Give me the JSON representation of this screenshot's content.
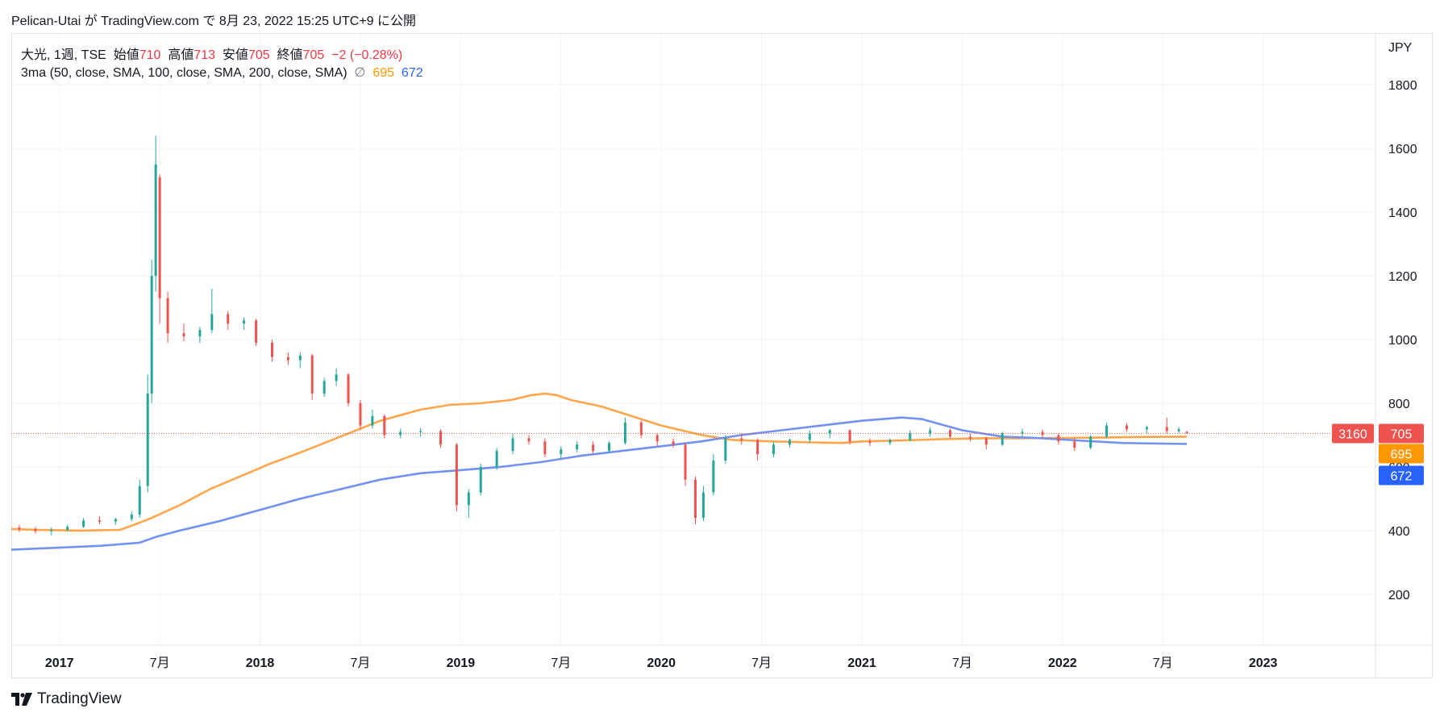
{
  "caption": "Pelican-Utai が TradingView.com で 8月 23, 2022 15:25 UTC+9 に公開",
  "legend": {
    "symbol": "大光, 1週, TSE",
    "open_label": "始値",
    "open": "710",
    "high_label": "高値",
    "high": "713",
    "low_label": "安値",
    "low": "705",
    "close_label": "終値",
    "close": "705",
    "change": "−2 (−0.28%)",
    "indicator": "3ma (50, close, SMA, 100, close, SMA, 200, close, SMA)",
    "hidden_symbol": "∅",
    "ma1_value": "695",
    "ma2_value": "672"
  },
  "currency": "JPY",
  "footer": {
    "brand": "TradingView"
  },
  "colors": {
    "up": "#26a69a",
    "down": "#ef5350",
    "ma1": "#ffa64d",
    "ma2": "#7391f0",
    "badge_countdown": "#ef5350"
  },
  "badges": {
    "countdown": "3160",
    "price": "705",
    "ma1": "695",
    "ma2": "672"
  },
  "chart_data": {
    "type": "candlestick",
    "title": "",
    "ylabel": "JPY",
    "ylim": [
      40,
      1960
    ],
    "y_ticks": [
      200,
      400,
      600,
      800,
      1000,
      1200,
      1400,
      1600,
      1800
    ],
    "x_ticks": [
      {
        "label": "2017",
        "t": 2017.0
      },
      {
        "label": "7月",
        "t": 2017.5
      },
      {
        "label": "2018",
        "t": 2018.0
      },
      {
        "label": "7月",
        "t": 2018.5
      },
      {
        "label": "2019",
        "t": 2019.0
      },
      {
        "label": "7月",
        "t": 2019.5
      },
      {
        "label": "2020",
        "t": 2020.0
      },
      {
        "label": "7月",
        "t": 2020.5
      },
      {
        "label": "2021",
        "t": 2021.0
      },
      {
        "label": "7月",
        "t": 2021.5
      },
      {
        "label": "2022",
        "t": 2022.0
      },
      {
        "label": "7月",
        "t": 2022.5
      },
      {
        "label": "2023",
        "t": 2023.0
      }
    ],
    "xlim": [
      2016.76,
      2023.56
    ],
    "last_price": 705,
    "grid": true,
    "candles": [
      {
        "t": 2016.8,
        "o": 410,
        "h": 418,
        "l": 395,
        "c": 405
      },
      {
        "t": 2016.88,
        "o": 405,
        "h": 412,
        "l": 390,
        "c": 398
      },
      {
        "t": 2016.96,
        "o": 398,
        "h": 410,
        "l": 385,
        "c": 402
      },
      {
        "t": 2017.04,
        "o": 402,
        "h": 418,
        "l": 398,
        "c": 412
      },
      {
        "t": 2017.12,
        "o": 412,
        "h": 440,
        "l": 408,
        "c": 432
      },
      {
        "t": 2017.2,
        "o": 432,
        "h": 445,
        "l": 420,
        "c": 428
      },
      {
        "t": 2017.28,
        "o": 428,
        "h": 440,
        "l": 418,
        "c": 436
      },
      {
        "t": 2017.36,
        "o": 436,
        "h": 460,
        "l": 430,
        "c": 450
      },
      {
        "t": 2017.4,
        "o": 450,
        "h": 560,
        "l": 440,
        "c": 540
      },
      {
        "t": 2017.44,
        "o": 540,
        "h": 890,
        "l": 520,
        "c": 830
      },
      {
        "t": 2017.46,
        "o": 830,
        "h": 1250,
        "l": 800,
        "c": 1200
      },
      {
        "t": 2017.48,
        "o": 1200,
        "h": 1640,
        "l": 1150,
        "c": 1550
      },
      {
        "t": 2017.5,
        "o": 1510,
        "h": 1520,
        "l": 1050,
        "c": 1130
      },
      {
        "t": 2017.54,
        "o": 1130,
        "h": 1150,
        "l": 990,
        "c": 1020
      },
      {
        "t": 2017.62,
        "o": 1020,
        "h": 1050,
        "l": 995,
        "c": 1010
      },
      {
        "t": 2017.7,
        "o": 1010,
        "h": 1040,
        "l": 990,
        "c": 1030
      },
      {
        "t": 2017.76,
        "o": 1030,
        "h": 1160,
        "l": 1020,
        "c": 1080
      },
      {
        "t": 2017.84,
        "o": 1080,
        "h": 1090,
        "l": 1030,
        "c": 1050
      },
      {
        "t": 2017.92,
        "o": 1050,
        "h": 1070,
        "l": 1030,
        "c": 1060
      },
      {
        "t": 2017.98,
        "o": 1060,
        "h": 1065,
        "l": 980,
        "c": 990
      },
      {
        "t": 2018.06,
        "o": 990,
        "h": 1000,
        "l": 930,
        "c": 945
      },
      {
        "t": 2018.14,
        "o": 945,
        "h": 960,
        "l": 920,
        "c": 935
      },
      {
        "t": 2018.2,
        "o": 935,
        "h": 960,
        "l": 910,
        "c": 950
      },
      {
        "t": 2018.26,
        "o": 950,
        "h": 955,
        "l": 810,
        "c": 830
      },
      {
        "t": 2018.32,
        "o": 830,
        "h": 880,
        "l": 820,
        "c": 870
      },
      {
        "t": 2018.38,
        "o": 870,
        "h": 910,
        "l": 855,
        "c": 890
      },
      {
        "t": 2018.44,
        "o": 890,
        "h": 895,
        "l": 790,
        "c": 800
      },
      {
        "t": 2018.5,
        "o": 800,
        "h": 810,
        "l": 715,
        "c": 730
      },
      {
        "t": 2018.56,
        "o": 730,
        "h": 780,
        "l": 720,
        "c": 760
      },
      {
        "t": 2018.62,
        "o": 760,
        "h": 765,
        "l": 690,
        "c": 700
      },
      {
        "t": 2018.7,
        "o": 700,
        "h": 720,
        "l": 690,
        "c": 710
      },
      {
        "t": 2018.8,
        "o": 710,
        "h": 722,
        "l": 695,
        "c": 712
      },
      {
        "t": 2018.9,
        "o": 712,
        "h": 718,
        "l": 660,
        "c": 670
      },
      {
        "t": 2018.98,
        "o": 670,
        "h": 675,
        "l": 460,
        "c": 480
      },
      {
        "t": 2019.04,
        "o": 480,
        "h": 530,
        "l": 440,
        "c": 520
      },
      {
        "t": 2019.1,
        "o": 520,
        "h": 610,
        "l": 510,
        "c": 600
      },
      {
        "t": 2019.18,
        "o": 600,
        "h": 660,
        "l": 590,
        "c": 650
      },
      {
        "t": 2019.26,
        "o": 650,
        "h": 705,
        "l": 640,
        "c": 690
      },
      {
        "t": 2019.34,
        "o": 690,
        "h": 700,
        "l": 670,
        "c": 680
      },
      {
        "t": 2019.42,
        "o": 680,
        "h": 690,
        "l": 630,
        "c": 640
      },
      {
        "t": 2019.5,
        "o": 640,
        "h": 665,
        "l": 625,
        "c": 655
      },
      {
        "t": 2019.58,
        "o": 655,
        "h": 680,
        "l": 645,
        "c": 670
      },
      {
        "t": 2019.66,
        "o": 670,
        "h": 680,
        "l": 640,
        "c": 650
      },
      {
        "t": 2019.74,
        "o": 650,
        "h": 680,
        "l": 645,
        "c": 675
      },
      {
        "t": 2019.82,
        "o": 675,
        "h": 755,
        "l": 670,
        "c": 740
      },
      {
        "t": 2019.9,
        "o": 740,
        "h": 745,
        "l": 690,
        "c": 700
      },
      {
        "t": 2019.98,
        "o": 700,
        "h": 705,
        "l": 665,
        "c": 680
      },
      {
        "t": 2020.06,
        "o": 680,
        "h": 690,
        "l": 660,
        "c": 670
      },
      {
        "t": 2020.12,
        "o": 670,
        "h": 675,
        "l": 540,
        "c": 560
      },
      {
        "t": 2020.17,
        "o": 560,
        "h": 570,
        "l": 420,
        "c": 440
      },
      {
        "t": 2020.21,
        "o": 440,
        "h": 540,
        "l": 430,
        "c": 520
      },
      {
        "t": 2020.26,
        "o": 520,
        "h": 640,
        "l": 510,
        "c": 620
      },
      {
        "t": 2020.32,
        "o": 620,
        "h": 700,
        "l": 610,
        "c": 690
      },
      {
        "t": 2020.4,
        "o": 690,
        "h": 705,
        "l": 670,
        "c": 685
      },
      {
        "t": 2020.48,
        "o": 685,
        "h": 690,
        "l": 620,
        "c": 640
      },
      {
        "t": 2020.56,
        "o": 640,
        "h": 680,
        "l": 630,
        "c": 670
      },
      {
        "t": 2020.64,
        "o": 670,
        "h": 690,
        "l": 660,
        "c": 685
      },
      {
        "t": 2020.74,
        "o": 685,
        "h": 715,
        "l": 675,
        "c": 705
      },
      {
        "t": 2020.84,
        "o": 705,
        "h": 720,
        "l": 690,
        "c": 715
      },
      {
        "t": 2020.94,
        "o": 715,
        "h": 718,
        "l": 670,
        "c": 680
      },
      {
        "t": 2021.04,
        "o": 680,
        "h": 690,
        "l": 665,
        "c": 675
      },
      {
        "t": 2021.14,
        "o": 675,
        "h": 690,
        "l": 668,
        "c": 685
      },
      {
        "t": 2021.24,
        "o": 685,
        "h": 715,
        "l": 680,
        "c": 705
      },
      {
        "t": 2021.34,
        "o": 705,
        "h": 725,
        "l": 695,
        "c": 715
      },
      {
        "t": 2021.44,
        "o": 715,
        "h": 720,
        "l": 690,
        "c": 695
      },
      {
        "t": 2021.54,
        "o": 695,
        "h": 705,
        "l": 680,
        "c": 690
      },
      {
        "t": 2021.62,
        "o": 690,
        "h": 695,
        "l": 655,
        "c": 670
      },
      {
        "t": 2021.7,
        "o": 670,
        "h": 710,
        "l": 665,
        "c": 705
      },
      {
        "t": 2021.8,
        "o": 705,
        "h": 720,
        "l": 695,
        "c": 710
      },
      {
        "t": 2021.9,
        "o": 710,
        "h": 718,
        "l": 690,
        "c": 700
      },
      {
        "t": 2021.98,
        "o": 700,
        "h": 705,
        "l": 670,
        "c": 680
      },
      {
        "t": 2022.06,
        "o": 680,
        "h": 690,
        "l": 650,
        "c": 660
      },
      {
        "t": 2022.14,
        "o": 660,
        "h": 700,
        "l": 655,
        "c": 695
      },
      {
        "t": 2022.22,
        "o": 695,
        "h": 740,
        "l": 690,
        "c": 730
      },
      {
        "t": 2022.32,
        "o": 730,
        "h": 738,
        "l": 710,
        "c": 718
      },
      {
        "t": 2022.42,
        "o": 718,
        "h": 730,
        "l": 705,
        "c": 725
      },
      {
        "t": 2022.52,
        "o": 725,
        "h": 755,
        "l": 705,
        "c": 712
      },
      {
        "t": 2022.58,
        "o": 712,
        "h": 725,
        "l": 705,
        "c": 718
      },
      {
        "t": 2022.62,
        "o": 710,
        "h": 713,
        "l": 705,
        "c": 705
      }
    ],
    "series": [
      {
        "name": "50",
        "color": "#ffa64d",
        "points": [
          [
            2016.76,
            405
          ],
          [
            2016.9,
            402
          ],
          [
            2017.1,
            400
          ],
          [
            2017.3,
            402
          ],
          [
            2017.38,
            420
          ],
          [
            2017.46,
            440
          ],
          [
            2017.6,
            480
          ],
          [
            2017.75,
            530
          ],
          [
            2017.9,
            570
          ],
          [
            2018.05,
            610
          ],
          [
            2018.2,
            645
          ],
          [
            2018.4,
            695
          ],
          [
            2018.6,
            745
          ],
          [
            2018.8,
            780
          ],
          [
            2018.95,
            795
          ],
          [
            2019.1,
            800
          ],
          [
            2019.25,
            810
          ],
          [
            2019.35,
            825
          ],
          [
            2019.42,
            830
          ],
          [
            2019.48,
            825
          ],
          [
            2019.55,
            810
          ],
          [
            2019.7,
            790
          ],
          [
            2019.85,
            760
          ],
          [
            2020.0,
            730
          ],
          [
            2020.1,
            715
          ],
          [
            2020.2,
            700
          ],
          [
            2020.35,
            685
          ],
          [
            2020.55,
            680
          ],
          [
            2020.75,
            677
          ],
          [
            2020.9,
            675
          ],
          [
            2021.0,
            680
          ],
          [
            2021.2,
            683
          ],
          [
            2021.4,
            687
          ],
          [
            2021.6,
            690
          ],
          [
            2021.8,
            690
          ],
          [
            2022.0,
            691
          ],
          [
            2022.2,
            692
          ],
          [
            2022.4,
            694
          ],
          [
            2022.62,
            695
          ]
        ]
      },
      {
        "name": "100",
        "color": "#7391f0",
        "points": [
          [
            2016.76,
            340
          ],
          [
            2016.95,
            345
          ],
          [
            2017.2,
            352
          ],
          [
            2017.4,
            362
          ],
          [
            2017.48,
            380
          ],
          [
            2017.6,
            400
          ],
          [
            2017.8,
            430
          ],
          [
            2018.0,
            465
          ],
          [
            2018.2,
            500
          ],
          [
            2018.4,
            530
          ],
          [
            2018.6,
            560
          ],
          [
            2018.8,
            580
          ],
          [
            2019.0,
            590
          ],
          [
            2019.2,
            600
          ],
          [
            2019.4,
            615
          ],
          [
            2019.6,
            635
          ],
          [
            2019.8,
            650
          ],
          [
            2020.0,
            665
          ],
          [
            2020.2,
            680
          ],
          [
            2020.4,
            700
          ],
          [
            2020.6,
            715
          ],
          [
            2020.8,
            730
          ],
          [
            2021.0,
            745
          ],
          [
            2021.2,
            755
          ],
          [
            2021.3,
            750
          ],
          [
            2021.5,
            715
          ],
          [
            2021.7,
            695
          ],
          [
            2021.9,
            690
          ],
          [
            2022.1,
            682
          ],
          [
            2022.3,
            675
          ],
          [
            2022.62,
            672
          ]
        ]
      }
    ]
  }
}
